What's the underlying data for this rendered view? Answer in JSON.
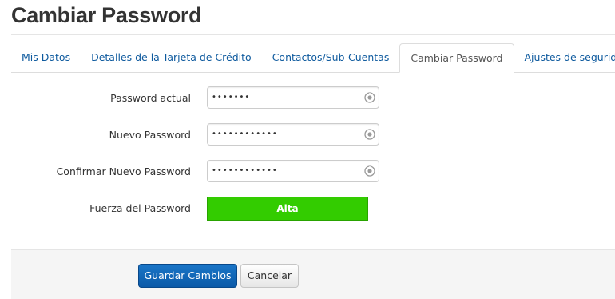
{
  "page": {
    "title": "Cambiar Password"
  },
  "tabs": [
    {
      "label": "Mis Datos",
      "active": false
    },
    {
      "label": "Detalles de la Tarjeta de Crédito",
      "active": false
    },
    {
      "label": "Contactos/Sub-Cuentas",
      "active": false
    },
    {
      "label": "Cambiar Password",
      "active": true
    },
    {
      "label": "Ajustes de seguridad",
      "active": false
    }
  ],
  "form": {
    "current_password": {
      "label": "Password actual",
      "value": "•••••••"
    },
    "new_password": {
      "label": "Nuevo Password",
      "value": "••••••••••••"
    },
    "confirm_password": {
      "label": "Confirmar Nuevo Password",
      "value": "••••••••••••"
    },
    "strength": {
      "label": "Fuerza del Password",
      "value": "Alta",
      "color": "#33cc00"
    }
  },
  "actions": {
    "save_label": "Guardar Cambios",
    "cancel_label": "Cancelar"
  },
  "icons": {
    "reveal": "eye-reveal-icon"
  },
  "colors": {
    "link": "#0e5a9e",
    "primary_button": "#0b5aa8"
  }
}
